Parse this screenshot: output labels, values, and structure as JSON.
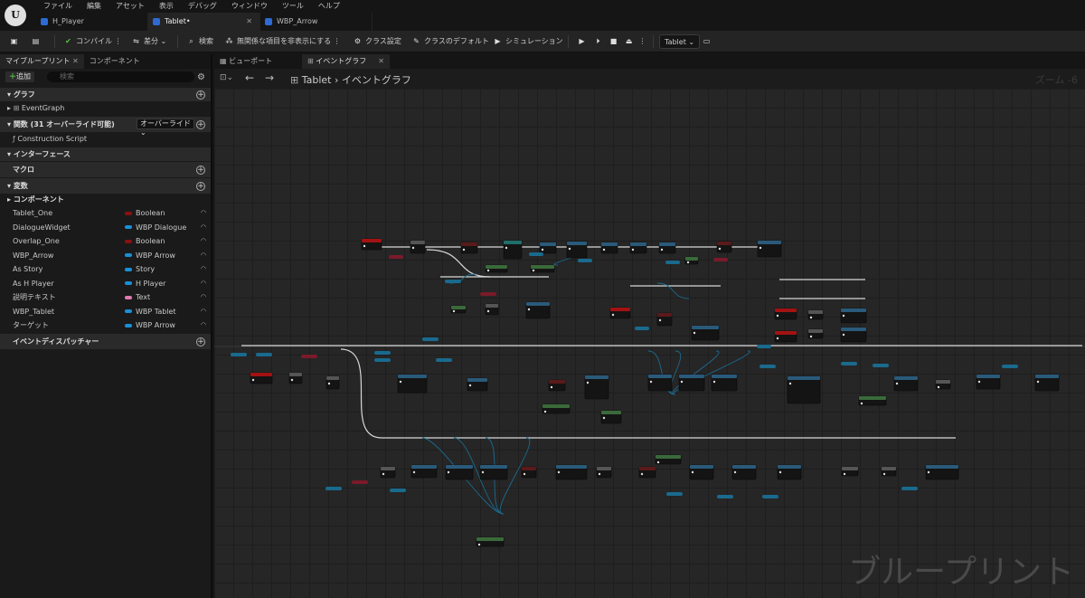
{
  "menu": [
    "ファイル",
    "編集",
    "アセット",
    "表示",
    "デバッグ",
    "ウィンドウ",
    "ツール",
    "ヘルプ"
  ],
  "tabs": [
    {
      "label": "H_Player"
    },
    {
      "label": "Tablet•"
    },
    {
      "label": "WBP_Arrow"
    }
  ],
  "toolbar": {
    "compile": "コンパイル",
    "diff": "差分",
    "search": "検索",
    "hide_unrelated": "無関係な項目を非表示にする",
    "class_settings": "クラス設定",
    "class_defaults": "クラスのデフォルト",
    "simulation": "シミュレーション",
    "debug_object": "Tablet"
  },
  "left_panel": {
    "tab_blueprint": "マイブループリント",
    "tab_components": "コンポーネント",
    "add": "追加",
    "search_placeholder": "検索",
    "graphs_header": "グラフ",
    "event_graph": "EventGraph",
    "functions_header": "関数 (31 オーバーライド可能)",
    "override": "オーバーライド",
    "construction_script": "Construction Script",
    "interfaces_header": "インターフェース",
    "macros_header": "マクロ",
    "variables_header": "変数",
    "components_sub": "コンポーネント",
    "dispatchers_header": "イベントディスパッチャー",
    "variables": [
      {
        "name": "Tablet_One",
        "type": "Boolean",
        "color": "#8a1010"
      },
      {
        "name": "DialogueWidget",
        "type": "WBP Dialogue",
        "color": "#1a8fd6"
      },
      {
        "name": "Overlap_One",
        "type": "Boolean",
        "color": "#8a1010"
      },
      {
        "name": "WBP_Arrow",
        "type": "WBP Arrow",
        "color": "#1a8fd6"
      },
      {
        "name": "As Story",
        "type": "Story",
        "color": "#1a8fd6"
      },
      {
        "name": "As H Player",
        "type": "H Player",
        "color": "#1a8fd6"
      },
      {
        "name": "説明テキスト",
        "type": "Text",
        "color": "#e07ab0"
      },
      {
        "name": "WBP_Tablet",
        "type": "WBP Tablet",
        "color": "#1a8fd6"
      },
      {
        "name": "ターゲット",
        "type": "WBP Arrow",
        "color": "#1a8fd6"
      }
    ]
  },
  "graph": {
    "tab_viewport": "ビューポート",
    "tab_eventgraph": "イベントグラフ",
    "breadcrumb_root": "Tablet",
    "breadcrumb_leaf": "イベントグラフ",
    "zoom": "ズーム -6",
    "watermark": "ブループリント"
  }
}
